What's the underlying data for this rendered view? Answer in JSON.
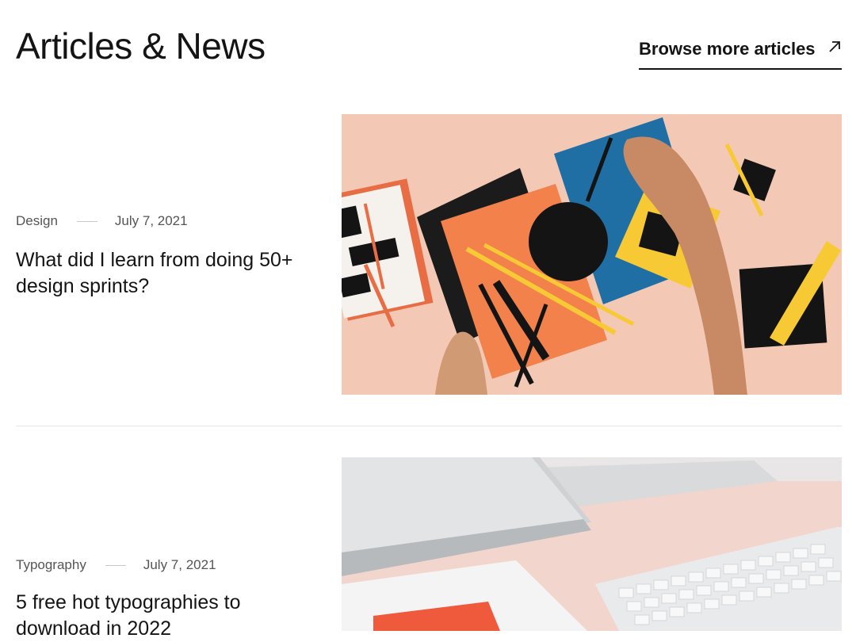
{
  "header": {
    "title": "Articles & News",
    "browse_label": "Browse more articles",
    "browse_icon": "arrow-up-right-icon"
  },
  "articles": [
    {
      "category": "Design",
      "date": "July 7, 2021",
      "title": "What did I learn from doing 50+ design sprints?",
      "image": "paper-shapes-collage-photo"
    },
    {
      "category": "Typography",
      "date": "July 7, 2021",
      "title": "5 free hot typographies to download in 2022",
      "image": "laptop-keyboard-desk-photo"
    }
  ],
  "colors": {
    "text": "#141414",
    "muted": "#555555",
    "divider": "#e6e6e6",
    "peach": "#f3c9b6",
    "orange": "#f2814b",
    "blue": "#1f6fa5",
    "yellow": "#f6c935"
  }
}
